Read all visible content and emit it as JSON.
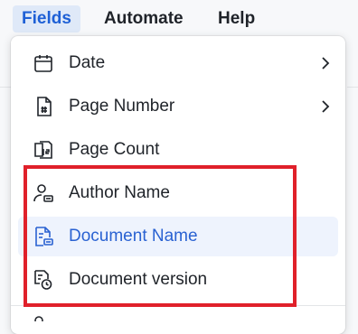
{
  "menubar": {
    "items": [
      {
        "label": "Fields",
        "active": true
      },
      {
        "label": "Automate",
        "active": false
      },
      {
        "label": "Help",
        "active": false
      }
    ]
  },
  "fields_menu": {
    "items": [
      {
        "label": "Date",
        "icon": "calendar-icon",
        "has_submenu": true
      },
      {
        "label": "Page Number",
        "icon": "page-number-icon",
        "has_submenu": true
      },
      {
        "label": "Page Count",
        "icon": "page-count-icon",
        "has_submenu": false
      },
      {
        "label": "Author Name",
        "icon": "author-icon",
        "has_submenu": false
      },
      {
        "label": "Document Name",
        "icon": "document-name-icon",
        "has_submenu": false,
        "hovered": true
      },
      {
        "label": "Document version",
        "icon": "document-version-icon",
        "has_submenu": false
      }
    ]
  },
  "colors": {
    "accent": "#2a62d2",
    "hover_bg": "#eef3fd",
    "active_tab_bg": "#dfe9f8",
    "annotation_border": "#e0202a"
  }
}
